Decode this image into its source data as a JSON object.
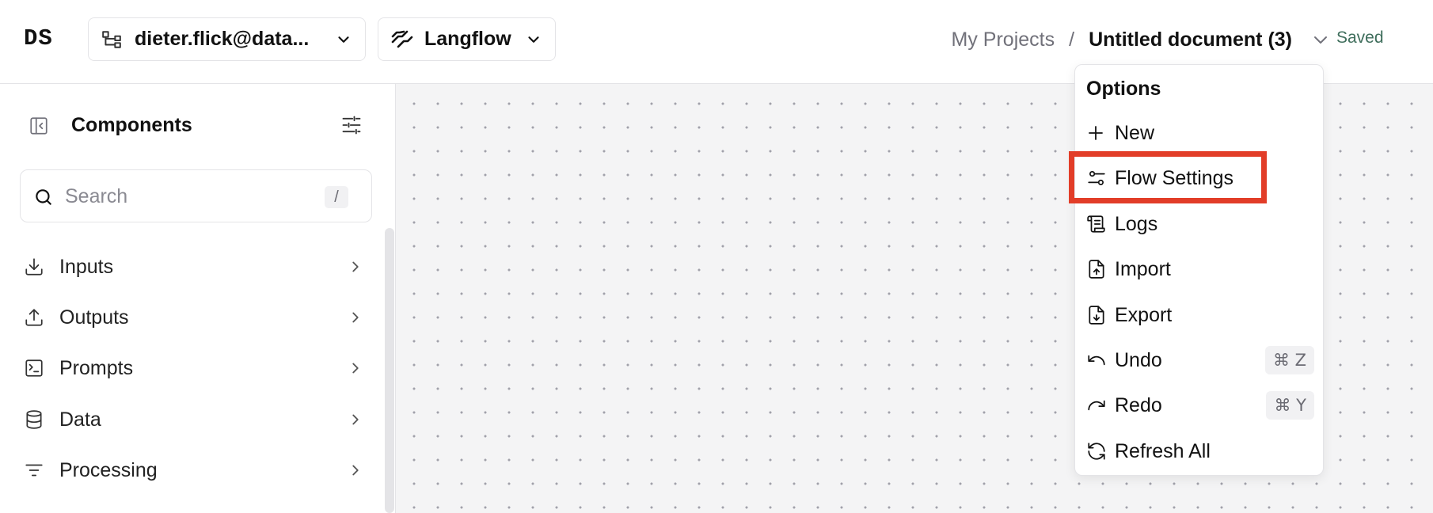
{
  "header": {
    "logo": "DS",
    "workspace_label": "dieter.flick@data...",
    "app_label": "Langflow",
    "breadcrumb_project": "My Projects",
    "breadcrumb_separator": "/",
    "document_title": "Untitled document (3)",
    "save_status": "Saved"
  },
  "sidebar": {
    "title": "Components",
    "search_placeholder": "Search",
    "search_shortcut": "/",
    "categories": [
      {
        "label": "Inputs",
        "icon": "download-icon"
      },
      {
        "label": "Outputs",
        "icon": "upload-icon"
      },
      {
        "label": "Prompts",
        "icon": "terminal-square-icon"
      },
      {
        "label": "Data",
        "icon": "database-icon"
      },
      {
        "label": "Processing",
        "icon": "list-filter-icon"
      }
    ]
  },
  "menu": {
    "title": "Options",
    "items": [
      {
        "label": "New",
        "icon": "plus-icon",
        "shortcut": ""
      },
      {
        "label": "Flow Settings",
        "icon": "settings-sliders-icon",
        "shortcut": ""
      },
      {
        "label": "Logs",
        "icon": "scroll-text-icon",
        "shortcut": ""
      },
      {
        "label": "Import",
        "icon": "file-up-icon",
        "shortcut": ""
      },
      {
        "label": "Export",
        "icon": "file-down-icon",
        "shortcut": ""
      },
      {
        "label": "Undo",
        "icon": "undo-icon",
        "shortcut": "⌘ Z"
      },
      {
        "label": "Redo",
        "icon": "redo-icon",
        "shortcut": "⌘ Y"
      },
      {
        "label": "Refresh All",
        "icon": "refresh-icon",
        "shortcut": ""
      }
    ],
    "highlighted_item": "Flow Settings"
  },
  "colors": {
    "highlight": "#e23d28",
    "saved_text": "#3f6e5c",
    "canvas_bg": "#f4f4f5"
  }
}
